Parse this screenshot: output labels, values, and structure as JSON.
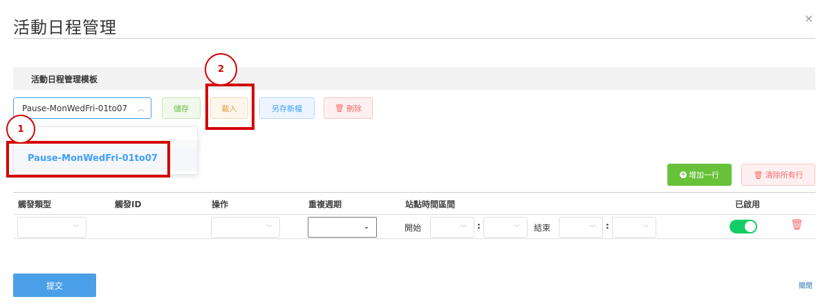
{
  "modal": {
    "title": "活動日程管理",
    "close_icon_glyph": "×",
    "close_link": "關閉"
  },
  "template_section": {
    "header": "活動日程管理模板",
    "selected_value": "Pause-MonWedFri-01to07",
    "caret_glyph": "^",
    "dropdown_options": [
      "Pause-MonWedFri-01to07"
    ],
    "buttons": {
      "save": "儲存",
      "load": "載入",
      "save_as": "另存新檔",
      "delete": "刪除"
    }
  },
  "annotations": [
    {
      "label": "1",
      "color": "#d40000"
    },
    {
      "label": "2",
      "color": "#d40000"
    }
  ],
  "rows_toolbar": {
    "add_row": "增加一行",
    "clear_all": "清除所有行"
  },
  "table": {
    "headers": [
      "觸發類型",
      "觸發ID",
      "操作",
      "重複週期",
      "站點時間區間",
      "已啟用"
    ],
    "row": {
      "start_label": "開始",
      "end_label": "結束",
      "separator": ":",
      "enabled": true
    }
  },
  "footer": {
    "submit": "提交"
  },
  "colors": {
    "primary": "#409eff",
    "success": "#67c23a",
    "warning": "#e6a23c",
    "danger": "#f56c6c",
    "toggle_on": "#13ce66",
    "annotation": "#d40000"
  }
}
